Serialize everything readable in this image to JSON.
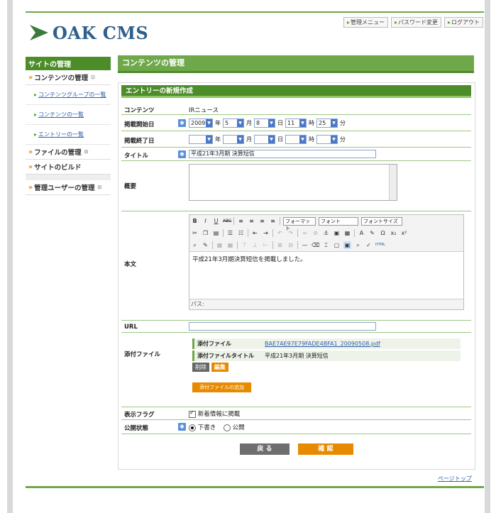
{
  "header": {
    "logo_text": "OAK CMS",
    "links": [
      "管理メニュー",
      "パスワード変更",
      "ログアウト"
    ]
  },
  "sidebar": {
    "head": "サイトの管理",
    "sections": [
      {
        "label": "コンテンツの管理",
        "subs": [
          "コンテンツグループの一覧",
          "コンテンツの一覧",
          "エントリーの一覧"
        ]
      },
      {
        "label": "ファイルの管理"
      },
      {
        "label": "サイトのビルド"
      },
      {
        "label": "管理ユーザーの管理"
      }
    ]
  },
  "main": {
    "title": "コンテンツの管理",
    "panel_title": "エントリーの新規作成"
  },
  "form": {
    "content": {
      "label": "コンテンツ",
      "value": "IRニュース"
    },
    "start": {
      "label": "掲載開始日",
      "year": "2009",
      "month": "5",
      "day": "8",
      "hour": "11",
      "minute": "25",
      "u_year": "年",
      "u_month": "月",
      "u_day": "日",
      "u_hour": "時",
      "u_min": "分"
    },
    "end": {
      "label": "掲載終了日"
    },
    "title": {
      "label": "タイトル",
      "value": "平成21年3月期 決算短信"
    },
    "summary": {
      "label": "概要"
    },
    "body": {
      "label": "本文",
      "content": "平成21年3月期決算短信を掲載しました。",
      "path": "パス:",
      "format": "フォーマット",
      "font": "フォント",
      "size": "フォントサイズ"
    },
    "url": {
      "label": "URL"
    },
    "attachment": {
      "label": "添付ファイル",
      "file_key": "添付ファイル",
      "file_value": "BAE7AE97E79FADE4BFA1_20090508.pdf",
      "title_key": "添付ファイルタイトル",
      "title_value": "平成21年3月期 決算短信",
      "delete": "削除",
      "edit": "編集",
      "add": "添付ファイルの追加"
    },
    "flag": {
      "label": "表示フラグ",
      "checkbox": "新着情報に掲載"
    },
    "status": {
      "label": "公開状態",
      "draft": "下書き",
      "publish": "公開"
    }
  },
  "buttons": {
    "back": "戻 る",
    "confirm": "確 認"
  },
  "footer": {
    "pagetop": "ページトップ"
  }
}
